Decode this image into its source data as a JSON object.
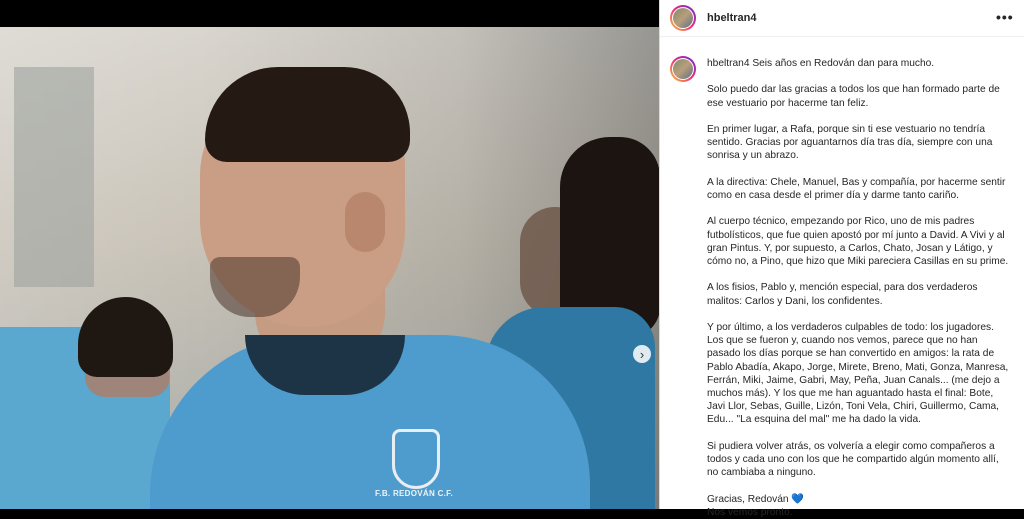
{
  "post": {
    "username": "hbeltran4",
    "more_icon": "•••",
    "caption_first": "Seis años en Redován dan para mucho.",
    "paragraphs": [
      "Solo puedo dar las gracias a todos los que han formado parte de ese vestuario por hacerme tan feliz.",
      "En primer lugar, a Rafa, porque sin ti ese vestuario no tendría sentido. Gracias por aguantarnos día tras día, siempre con una sonrisa y un abrazo.",
      "A la directiva: Chele, Manuel, Bas y compañía, por hacerme sentir como en casa desde el primer día y darme tanto cariño.",
      "Al cuerpo técnico, empezando por Rico, uno de mis padres futbolísticos, que fue quien apostó por mí junto a David. A Vivi y al gran Pintus. Y, por supuesto, a Carlos, Chato, Josan y Látigo, y cómo no, a Pino, que hizo que Miki pareciera Casillas en su prime.",
      "A los fisios, Pablo y, mención especial, para dos verdaderos malitos: Carlos y Dani, los confidentes.",
      "Y por último, a los verdaderos culpables de todo: los jugadores. Los que se fueron y, cuando nos vemos, parece que no han pasado los días porque se han convertido en amigos: la rata de Pablo Abadía, Akapo, Jorge, Mirete, Breno, Mati, Gonza, Manresa, Ferrán, Miki, Jaime, Gabri, May, Peña, Juan Canals... (me dejo a muchos más). Y los que me han aguantado hasta el final: Bote, Javi Llor, Sebas, Guille, Lizón, Toni Vela, Chiri, Guillermo, Cama, Edu... \"La esquina del mal\" me ha dado la vida.",
      "Si pudiera volver atrás, os volvería a elegir como compañeros a todos y cada uno con los que he compartido algún momento allí, no cambiaba a ninguno."
    ],
    "closing": "Gracias, Redován",
    "heart": "💙",
    "last_line": "Nos vemos pronto."
  },
  "photo": {
    "crest_text": "F.B. REDOVÁN C.F.",
    "next_icon": "›"
  },
  "colors": {
    "shirt": "#4d9ccd",
    "heart": "#1f5fae"
  }
}
